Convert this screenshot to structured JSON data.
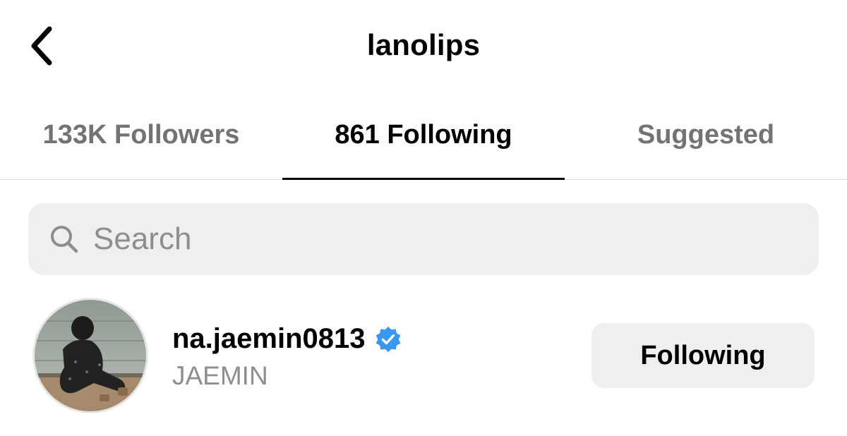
{
  "header": {
    "title": "lanolips",
    "back_icon": "chevron-left-icon"
  },
  "tabs": [
    {
      "label": "133K Followers",
      "active": false
    },
    {
      "label": "861 Following",
      "active": true
    },
    {
      "label": "Suggested",
      "active": false
    }
  ],
  "search": {
    "placeholder": "Search",
    "value": "",
    "icon": "search-icon"
  },
  "list": [
    {
      "username": "na.jaemin0813",
      "full_name": "JAEMIN",
      "verified": true,
      "button_label": "Following",
      "avatar_icon": "avatar-photo"
    }
  ],
  "colors": {
    "verified_blue": "#3897f0",
    "muted_text": "#737373",
    "button_bg": "#efefef"
  }
}
